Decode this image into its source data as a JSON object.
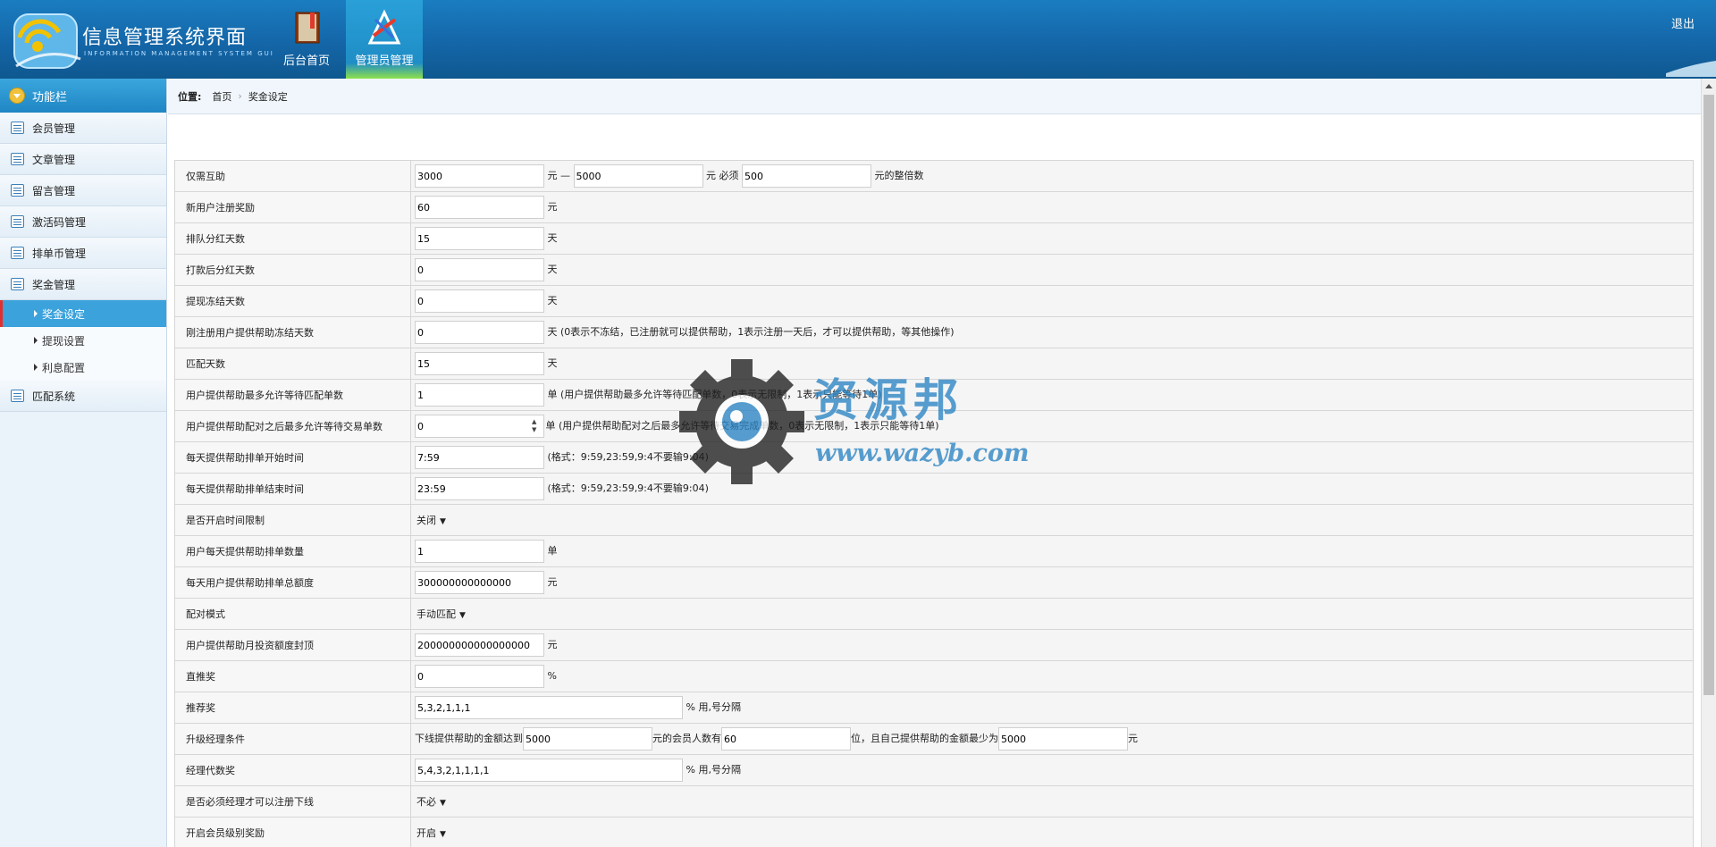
{
  "header": {
    "app_title": "信息管理系统界面",
    "app_subtitle": "INFORMATION MANAGEMENT SYSTEM GUI",
    "nav": [
      {
        "label": "后台首页",
        "icon": "book-icon"
      },
      {
        "label": "管理员管理",
        "icon": "tools-icon"
      }
    ],
    "logout": "退出"
  },
  "sidebar": {
    "title": "功能栏",
    "items": [
      {
        "label": "会员管理"
      },
      {
        "label": "文章管理"
      },
      {
        "label": "留言管理"
      },
      {
        "label": "激活码管理"
      },
      {
        "label": "排单币管理"
      },
      {
        "label": "奖金管理"
      }
    ],
    "sub_items": [
      {
        "label": "奖金设定",
        "active": true
      },
      {
        "label": "提现设置"
      },
      {
        "label": "利息配置"
      }
    ],
    "last_item": {
      "label": "匹配系统"
    }
  },
  "breadcrumb": {
    "position": "位置:",
    "home": "首页",
    "current": "奖金设定"
  },
  "form": {
    "r1": {
      "label": "仅需互助",
      "v1": "3000",
      "u1": "元 —",
      "v2": "5000",
      "u2": "元 必须",
      "v3": "500",
      "u3": "元的整倍数"
    },
    "r2": {
      "label": "新用户注册奖励",
      "value": "60",
      "unit": "元"
    },
    "r3": {
      "label": "排队分红天数",
      "value": "15",
      "unit": "天"
    },
    "r4": {
      "label": "打款后分红天数",
      "value": "0",
      "unit": "天"
    },
    "r5": {
      "label": "提现冻结天数",
      "value": "0",
      "unit": "天"
    },
    "r6": {
      "label": "刚注册用户提供帮助冻结天数",
      "value": "0",
      "unit": "天",
      "note": "(0表示不冻结，已注册就可以提供帮助，1表示注册一天后，才可以提供帮助，等其他操作)"
    },
    "r7": {
      "label": "匹配天数",
      "value": "15",
      "unit": "天"
    },
    "r8": {
      "label": "用户提供帮助最多允许等待匹配单数",
      "value": "1",
      "unit": "单",
      "note": "(用户提供帮助最多允许等待匹配单数，0表示无限制，1表示只能等待1单)"
    },
    "r9": {
      "label": "用户提供帮助配对之后最多允许等待交易单数",
      "value": "0",
      "unit": "单",
      "note": "(用户提供帮助配对之后最多允许等待交易完成单数，0表示无限制，1表示只能等待1单)"
    },
    "r10": {
      "label": "每天提供帮助排单开始时间",
      "value": "7:59",
      "note": "(格式：9:59,23:59,9:4不要输9:04)"
    },
    "r11": {
      "label": "每天提供帮助排单结束时间",
      "value": "23:59",
      "note": "(格式：9:59,23:59,9:4不要输9:04)"
    },
    "r12": {
      "label": "是否开启时间限制",
      "value": "关闭"
    },
    "r13": {
      "label": "用户每天提供帮助排单数量",
      "value": "1",
      "unit": "单"
    },
    "r14": {
      "label": "每天用户提供帮助排单总额度",
      "value": "300000000000000",
      "unit": "元"
    },
    "r15": {
      "label": "配对模式",
      "value": "手动匹配"
    },
    "r16": {
      "label": "用户提供帮助月投资额度封顶",
      "value": "200000000000000000",
      "unit": "元"
    },
    "r17": {
      "label": "直推奖",
      "value": "0",
      "unit": "%"
    },
    "r18": {
      "label": "推荐奖",
      "value": "5,3,2,1,1,1",
      "unit": "% 用,号分隔"
    },
    "r19": {
      "label": "升级经理条件",
      "t1": "下线提供帮助的金额达到",
      "v1": "5000",
      "t2": "元的会员人数有",
      "v2": "60",
      "t3": "位，且自己提供帮助的金额最少为",
      "v3": "5000",
      "t4": "元"
    },
    "r20": {
      "label": "经理代数奖",
      "value": "5,4,3,2,1,1,1,1",
      "unit": "% 用,号分隔"
    },
    "r21": {
      "label": "是否必须经理才可以注册下线",
      "value": "不必"
    },
    "r22": {
      "label": "开启会员级别奖励",
      "value": "开启"
    }
  },
  "watermark": {
    "title": "资源邦",
    "url": "www.wazyb.com"
  },
  "colors": {
    "header": "#1466a8",
    "accent": "#3ba2dc",
    "sidebar": "#eaf3fa"
  }
}
